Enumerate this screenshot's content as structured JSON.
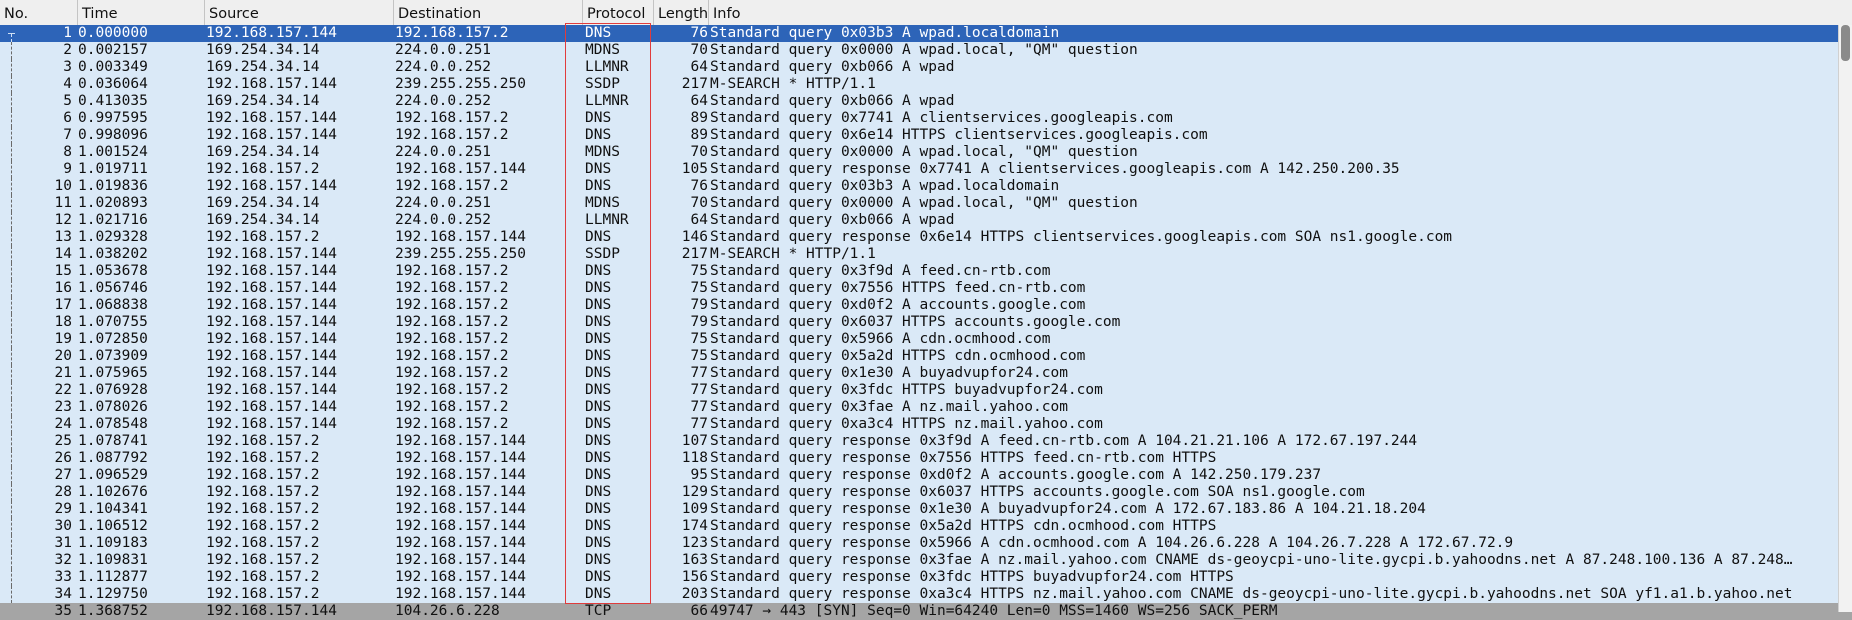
{
  "columns": [
    {
      "key": "no",
      "label": "No."
    },
    {
      "key": "time",
      "label": "Time"
    },
    {
      "key": "source",
      "label": "Source"
    },
    {
      "key": "destination",
      "label": "Destination"
    },
    {
      "key": "protocol",
      "label": "Protocol"
    },
    {
      "key": "length",
      "label": "Length"
    },
    {
      "key": "info",
      "label": "Info"
    }
  ],
  "colors": {
    "row_bg": "#dae9f7",
    "selected_bg": "#2d64b8",
    "tcp_bg": "#a5a5a5",
    "highlight_box": "#e03c3c"
  },
  "packets": [
    {
      "no": "1",
      "time": "0.000000",
      "source": "192.168.157.144",
      "destination": "192.168.157.2",
      "protocol": "DNS",
      "length": "76",
      "info": "Standard query 0x03b3 A wpad.localdomain",
      "selected": true
    },
    {
      "no": "2",
      "time": "0.002157",
      "source": "169.254.34.14",
      "destination": "224.0.0.251",
      "protocol": "MDNS",
      "length": "70",
      "info": "Standard query 0x0000 A wpad.local, \"QM\" question"
    },
    {
      "no": "3",
      "time": "0.003349",
      "source": "169.254.34.14",
      "destination": "224.0.0.252",
      "protocol": "LLMNR",
      "length": "64",
      "info": "Standard query 0xb066 A wpad"
    },
    {
      "no": "4",
      "time": "0.036064",
      "source": "192.168.157.144",
      "destination": "239.255.255.250",
      "protocol": "SSDP",
      "length": "217",
      "info": "M-SEARCH * HTTP/1.1"
    },
    {
      "no": "5",
      "time": "0.413035",
      "source": "169.254.34.14",
      "destination": "224.0.0.252",
      "protocol": "LLMNR",
      "length": "64",
      "info": "Standard query 0xb066 A wpad"
    },
    {
      "no": "6",
      "time": "0.997595",
      "source": "192.168.157.144",
      "destination": "192.168.157.2",
      "protocol": "DNS",
      "length": "89",
      "info": "Standard query 0x7741 A clientservices.googleapis.com"
    },
    {
      "no": "7",
      "time": "0.998096",
      "source": "192.168.157.144",
      "destination": "192.168.157.2",
      "protocol": "DNS",
      "length": "89",
      "info": "Standard query 0x6e14 HTTPS clientservices.googleapis.com"
    },
    {
      "no": "8",
      "time": "1.001524",
      "source": "169.254.34.14",
      "destination": "224.0.0.251",
      "protocol": "MDNS",
      "length": "70",
      "info": "Standard query 0x0000 A wpad.local, \"QM\" question"
    },
    {
      "no": "9",
      "time": "1.019711",
      "source": "192.168.157.2",
      "destination": "192.168.157.144",
      "protocol": "DNS",
      "length": "105",
      "info": "Standard query response 0x7741 A clientservices.googleapis.com A 142.250.200.35"
    },
    {
      "no": "10",
      "time": "1.019836",
      "source": "192.168.157.144",
      "destination": "192.168.157.2",
      "protocol": "DNS",
      "length": "76",
      "info": "Standard query 0x03b3 A wpad.localdomain"
    },
    {
      "no": "11",
      "time": "1.020893",
      "source": "169.254.34.14",
      "destination": "224.0.0.251",
      "protocol": "MDNS",
      "length": "70",
      "info": "Standard query 0x0000 A wpad.local, \"QM\" question"
    },
    {
      "no": "12",
      "time": "1.021716",
      "source": "169.254.34.14",
      "destination": "224.0.0.252",
      "protocol": "LLMNR",
      "length": "64",
      "info": "Standard query 0xb066 A wpad"
    },
    {
      "no": "13",
      "time": "1.029328",
      "source": "192.168.157.2",
      "destination": "192.168.157.144",
      "protocol": "DNS",
      "length": "146",
      "info": "Standard query response 0x6e14 HTTPS clientservices.googleapis.com SOA ns1.google.com"
    },
    {
      "no": "14",
      "time": "1.038202",
      "source": "192.168.157.144",
      "destination": "239.255.255.250",
      "protocol": "SSDP",
      "length": "217",
      "info": "M-SEARCH * HTTP/1.1"
    },
    {
      "no": "15",
      "time": "1.053678",
      "source": "192.168.157.144",
      "destination": "192.168.157.2",
      "protocol": "DNS",
      "length": "75",
      "info": "Standard query 0x3f9d A feed.cn-rtb.com"
    },
    {
      "no": "16",
      "time": "1.056746",
      "source": "192.168.157.144",
      "destination": "192.168.157.2",
      "protocol": "DNS",
      "length": "75",
      "info": "Standard query 0x7556 HTTPS feed.cn-rtb.com"
    },
    {
      "no": "17",
      "time": "1.068838",
      "source": "192.168.157.144",
      "destination": "192.168.157.2",
      "protocol": "DNS",
      "length": "79",
      "info": "Standard query 0xd0f2 A accounts.google.com"
    },
    {
      "no": "18",
      "time": "1.070755",
      "source": "192.168.157.144",
      "destination": "192.168.157.2",
      "protocol": "DNS",
      "length": "79",
      "info": "Standard query 0x6037 HTTPS accounts.google.com"
    },
    {
      "no": "19",
      "time": "1.072850",
      "source": "192.168.157.144",
      "destination": "192.168.157.2",
      "protocol": "DNS",
      "length": "75",
      "info": "Standard query 0x5966 A cdn.ocmhood.com"
    },
    {
      "no": "20",
      "time": "1.073909",
      "source": "192.168.157.144",
      "destination": "192.168.157.2",
      "protocol": "DNS",
      "length": "75",
      "info": "Standard query 0x5a2d HTTPS cdn.ocmhood.com"
    },
    {
      "no": "21",
      "time": "1.075965",
      "source": "192.168.157.144",
      "destination": "192.168.157.2",
      "protocol": "DNS",
      "length": "77",
      "info": "Standard query 0x1e30 A buyadvupfor24.com"
    },
    {
      "no": "22",
      "time": "1.076928",
      "source": "192.168.157.144",
      "destination": "192.168.157.2",
      "protocol": "DNS",
      "length": "77",
      "info": "Standard query 0x3fdc HTTPS buyadvupfor24.com"
    },
    {
      "no": "23",
      "time": "1.078026",
      "source": "192.168.157.144",
      "destination": "192.168.157.2",
      "protocol": "DNS",
      "length": "77",
      "info": "Standard query 0x3fae A nz.mail.yahoo.com"
    },
    {
      "no": "24",
      "time": "1.078548",
      "source": "192.168.157.144",
      "destination": "192.168.157.2",
      "protocol": "DNS",
      "length": "77",
      "info": "Standard query 0xa3c4 HTTPS nz.mail.yahoo.com"
    },
    {
      "no": "25",
      "time": "1.078741",
      "source": "192.168.157.2",
      "destination": "192.168.157.144",
      "protocol": "DNS",
      "length": "107",
      "info": "Standard query response 0x3f9d A feed.cn-rtb.com A 104.21.21.106 A 172.67.197.244"
    },
    {
      "no": "26",
      "time": "1.087792",
      "source": "192.168.157.2",
      "destination": "192.168.157.144",
      "protocol": "DNS",
      "length": "118",
      "info": "Standard query response 0x7556 HTTPS feed.cn-rtb.com HTTPS"
    },
    {
      "no": "27",
      "time": "1.096529",
      "source": "192.168.157.2",
      "destination": "192.168.157.144",
      "protocol": "DNS",
      "length": "95",
      "info": "Standard query response 0xd0f2 A accounts.google.com A 142.250.179.237"
    },
    {
      "no": "28",
      "time": "1.102676",
      "source": "192.168.157.2",
      "destination": "192.168.157.144",
      "protocol": "DNS",
      "length": "129",
      "info": "Standard query response 0x6037 HTTPS accounts.google.com SOA ns1.google.com"
    },
    {
      "no": "29",
      "time": "1.104341",
      "source": "192.168.157.2",
      "destination": "192.168.157.144",
      "protocol": "DNS",
      "length": "109",
      "info": "Standard query response 0x1e30 A buyadvupfor24.com A 172.67.183.86 A 104.21.18.204"
    },
    {
      "no": "30",
      "time": "1.106512",
      "source": "192.168.157.2",
      "destination": "192.168.157.144",
      "protocol": "DNS",
      "length": "174",
      "info": "Standard query response 0x5a2d HTTPS cdn.ocmhood.com HTTPS"
    },
    {
      "no": "31",
      "time": "1.109183",
      "source": "192.168.157.2",
      "destination": "192.168.157.144",
      "protocol": "DNS",
      "length": "123",
      "info": "Standard query response 0x5966 A cdn.ocmhood.com A 104.26.6.228 A 104.26.7.228 A 172.67.72.9"
    },
    {
      "no": "32",
      "time": "1.109831",
      "source": "192.168.157.2",
      "destination": "192.168.157.144",
      "protocol": "DNS",
      "length": "163",
      "info": "Standard query response 0x3fae A nz.mail.yahoo.com CNAME ds-geoycpi-uno-lite.gycpi.b.yahoodns.net A 87.248.100.136 A 87.248…"
    },
    {
      "no": "33",
      "time": "1.112877",
      "source": "192.168.157.2",
      "destination": "192.168.157.144",
      "protocol": "DNS",
      "length": "156",
      "info": "Standard query response 0x3fdc HTTPS buyadvupfor24.com HTTPS"
    },
    {
      "no": "34",
      "time": "1.129750",
      "source": "192.168.157.2",
      "destination": "192.168.157.144",
      "protocol": "DNS",
      "length": "203",
      "info": "Standard query response 0xa3c4 HTTPS nz.mail.yahoo.com CNAME ds-geoycpi-uno-lite.gycpi.b.yahoodns.net SOA yf1.a1.b.yahoo.net"
    },
    {
      "no": "35",
      "time": "1.368752",
      "source": "192.168.157.144",
      "destination": "104.26.6.228",
      "protocol": "TCP",
      "length": "66",
      "info": "49747 → 443 [SYN] Seq=0 Win=64240 Len=0 MSS=1460 WS=256 SACK_PERM",
      "tcp": true
    }
  ]
}
